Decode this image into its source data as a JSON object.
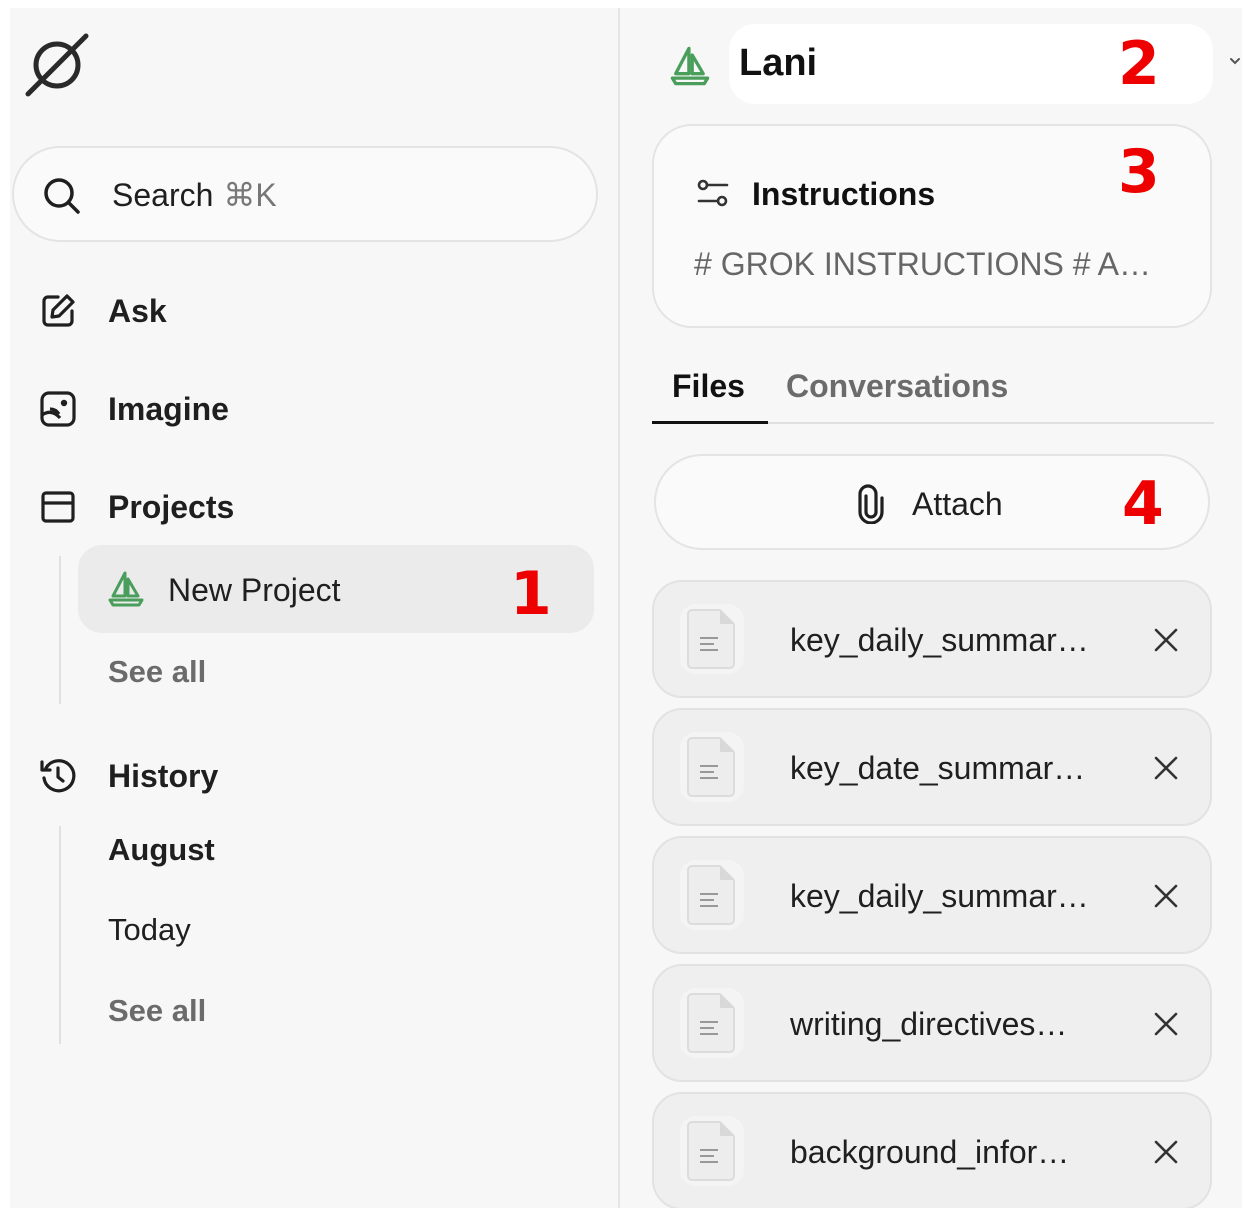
{
  "sidebar": {
    "logo_icon": "grok-logo-icon",
    "search": {
      "label": "Search",
      "shortcut": "⌘K"
    },
    "nav": [
      {
        "label": "Ask",
        "icon": "edit-icon"
      },
      {
        "label": "Imagine",
        "icon": "image-icon"
      },
      {
        "label": "Projects",
        "icon": "folder-icon"
      },
      {
        "label": "History",
        "icon": "history-icon"
      }
    ],
    "projects": {
      "active_project": {
        "label": "New Project",
        "icon": "sailboat-icon"
      },
      "see_all": "See all"
    },
    "history": {
      "month": "August",
      "today": "Today",
      "see_all": "See all"
    }
  },
  "panel": {
    "project_name": "Lani",
    "project_icon": "sailboat-icon",
    "instructions": {
      "title": "Instructions",
      "preview": "# GROK INSTRUCTIONS # A…"
    },
    "tabs": [
      {
        "label": "Files",
        "active": true
      },
      {
        "label": "Conversations",
        "active": false
      }
    ],
    "attach_label": "Attach",
    "files": [
      {
        "name": "key_daily_summar…"
      },
      {
        "name": "key_date_summar…"
      },
      {
        "name": "key_daily_summar…"
      },
      {
        "name": "writing_directives…"
      },
      {
        "name": "background_infor…"
      }
    ]
  },
  "annotations": [
    "1",
    "2",
    "3",
    "4"
  ],
  "colors": {
    "accent_green": "#4a9e5c",
    "marker_red": "#ee0000"
  }
}
